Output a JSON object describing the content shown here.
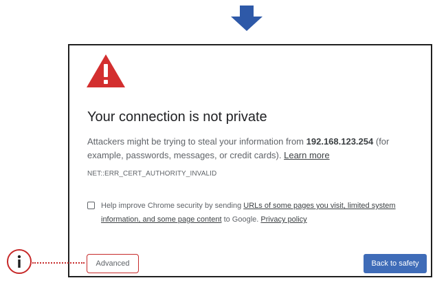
{
  "colors": {
    "arrow": "#2e59a8",
    "warning_red": "#d32f2f",
    "callout_red": "#c62828",
    "primary_button": "#3f6cb8"
  },
  "icons": {
    "top": "arrow-down-icon",
    "warning": "warning-triangle-icon",
    "info": "info-icon"
  },
  "page": {
    "title": "Your connection is not private",
    "description": {
      "prefix": "Attackers might be trying to steal your information from ",
      "host": "192.168.123.254",
      "suffix": " (for example, passwords, messages, or credit cards). ",
      "learn_more": "Learn more"
    },
    "error_code": "NET::ERR_CERT_AUTHORITY_INVALID",
    "checkbox": {
      "checked": false,
      "text_prefix": "Help improve Chrome security by sending ",
      "link1": "URLs of some pages you visit, limited system information, and some page content",
      "text_middle": " to Google. ",
      "link2": "Privacy policy"
    }
  },
  "buttons": {
    "advanced": "Advanced",
    "back_to_safety": "Back to safety"
  }
}
